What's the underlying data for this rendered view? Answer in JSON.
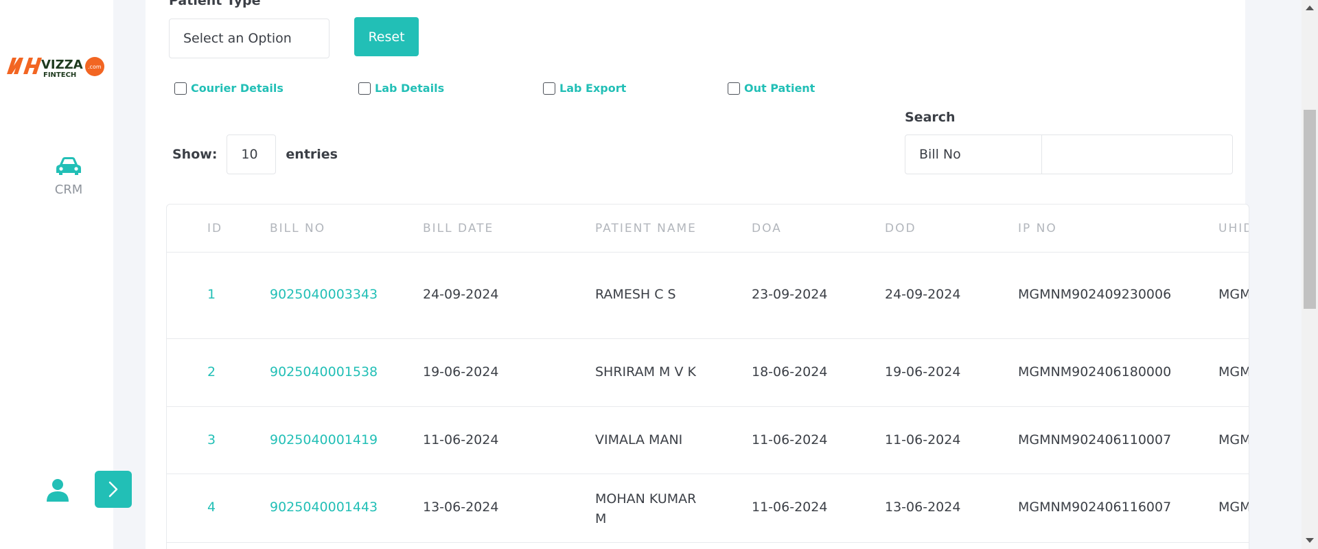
{
  "sidebar": {
    "logo": {
      "text": "VIZZA",
      "sub": "FINTECH",
      "suffix": ".com"
    },
    "nav_items": [
      {
        "label": "CRM",
        "icon": "car-icon"
      }
    ],
    "user_icon": "user-icon",
    "expand_icon": "chevron-right-icon"
  },
  "filters": {
    "patient_type_label": "Patient Type",
    "patient_type_value": "Select an Option",
    "reset_label": "Reset",
    "checkboxes": [
      "Courier Details",
      "Lab Details",
      "Lab Export",
      "Out Patient"
    ]
  },
  "table_controls": {
    "show_label": "Show:",
    "entries_value": "10",
    "entries_label": "entries",
    "search_label": "Search",
    "search_field": "Bill No",
    "search_value": ""
  },
  "table": {
    "headers": [
      "ID",
      "BILL NO",
      "BILL DATE",
      "PATIENT NAME",
      "DOA",
      "DOD",
      "IP NO",
      "UHID"
    ],
    "rows": [
      {
        "id": "1",
        "bill_no": "9025040003343",
        "bill_date": "24-09-2024",
        "patient_name": "RAMESH C S",
        "doa": "23-09-2024",
        "dod": "24-09-2024",
        "ip_no": "MGMNM902409230006",
        "uhid": "MGM"
      },
      {
        "id": "2",
        "bill_no": "9025040001538",
        "bill_date": "19-06-2024",
        "patient_name": "SHRIRAM M V K",
        "doa": "18-06-2024",
        "dod": "19-06-2024",
        "ip_no": "MGMNM902406180000",
        "uhid": "MGM"
      },
      {
        "id": "3",
        "bill_no": "9025040001419",
        "bill_date": "11-06-2024",
        "patient_name": "VIMALA MANI",
        "doa": "11-06-2024",
        "dod": "11-06-2024",
        "ip_no": "MGMNM902406110007",
        "uhid": "MGM"
      },
      {
        "id": "4",
        "bill_no": "9025040001443",
        "bill_date": "13-06-2024",
        "patient_name": "MOHAN KUMAR M",
        "doa": "11-06-2024",
        "dod": "13-06-2024",
        "ip_no": "MGMNM902406116007",
        "uhid": "MGM"
      }
    ]
  },
  "colors": {
    "accent": "#22bfb6",
    "text": "#3b3f46",
    "muted": "#b2b6bc",
    "background": "#f3f5f9"
  }
}
